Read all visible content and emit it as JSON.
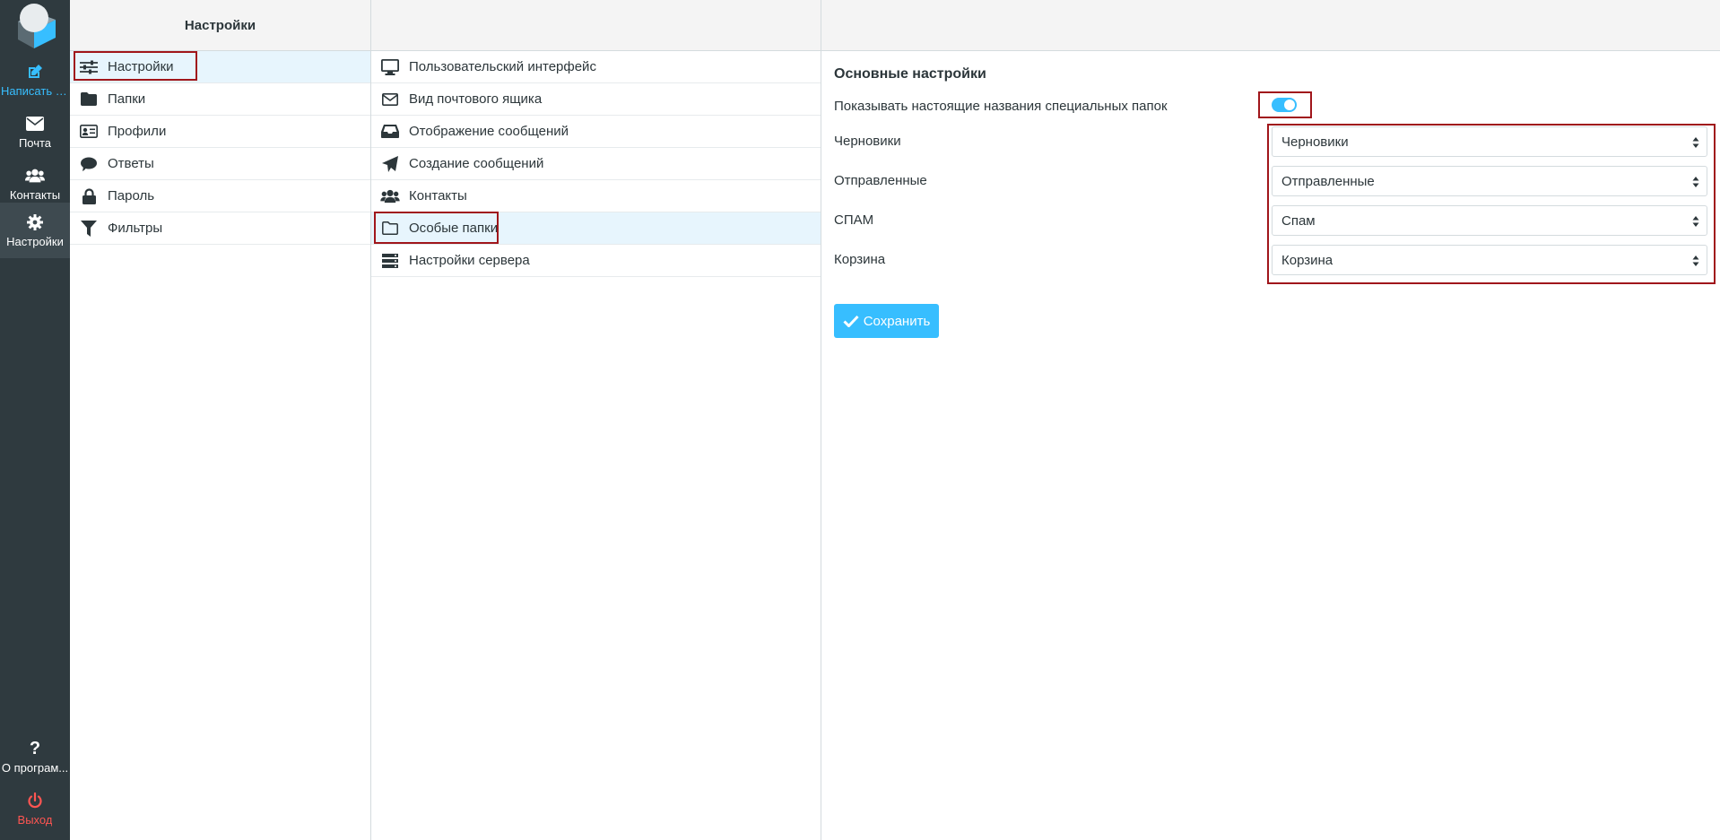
{
  "rail": {
    "logo_icon": "roundcube-logo-icon",
    "compose": {
      "label": "Написать с...",
      "icon": "edit-icon"
    },
    "mail": {
      "label": "Почта",
      "icon": "envelope-icon"
    },
    "contacts": {
      "label": "Контакты",
      "icon": "users-icon"
    },
    "settings": {
      "label": "Настройки",
      "icon": "gear-icon"
    },
    "about": {
      "label": "О програм...",
      "icon": "question-icon"
    },
    "logout": {
      "label": "Выход",
      "icon": "power-icon"
    }
  },
  "col1": {
    "title": "Настройки",
    "items": [
      {
        "label": "Настройки",
        "icon": "sliders-icon"
      },
      {
        "label": "Папки",
        "icon": "folder-icon"
      },
      {
        "label": "Профили",
        "icon": "id-card-icon"
      },
      {
        "label": "Ответы",
        "icon": "comment-icon"
      },
      {
        "label": "Пароль",
        "icon": "lock-icon"
      },
      {
        "label": "Фильтры",
        "icon": "filter-icon"
      }
    ]
  },
  "col2": {
    "items": [
      {
        "label": "Пользовательский интерфейс",
        "icon": "desktop-icon"
      },
      {
        "label": "Вид почтового ящика",
        "icon": "envelope-outline-icon"
      },
      {
        "label": "Отображение сообщений",
        "icon": "inbox-icon"
      },
      {
        "label": "Создание сообщений",
        "icon": "paper-plane-icon"
      },
      {
        "label": "Контакты",
        "icon": "users-icon"
      },
      {
        "label": "Особые папки",
        "icon": "folder-outline-icon"
      },
      {
        "label": "Настройки сервера",
        "icon": "server-icon"
      }
    ]
  },
  "form": {
    "section_title": "Основные настройки",
    "show_real_names_label": "Показывать настоящие названия специальных папок",
    "show_real_names_on": true,
    "fields": [
      {
        "label": "Черновики",
        "value": "Черновики"
      },
      {
        "label": "Отправленные",
        "value": "Отправленные"
      },
      {
        "label": "СПАМ",
        "value": "Спам"
      },
      {
        "label": "Корзина",
        "value": "Корзина"
      }
    ],
    "save_label": "Сохранить"
  },
  "colors": {
    "rail_bg": "#2f3a3f",
    "accent": "#37beff",
    "logout": "#ff5552",
    "highlight_border": "#a0161b",
    "selected_bg": "#e7f5fd"
  }
}
